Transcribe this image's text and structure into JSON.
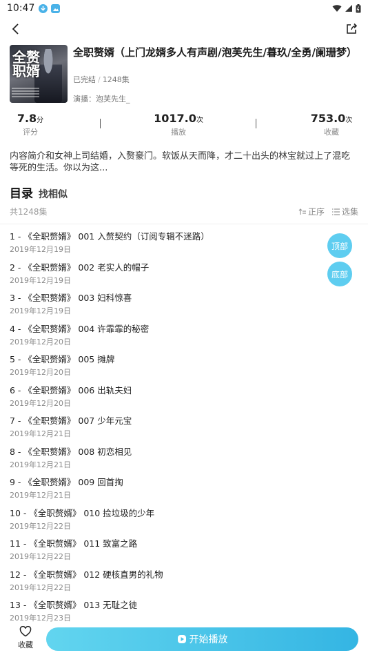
{
  "status_bar": {
    "time": "10:47"
  },
  "book": {
    "title": "全职赘婿（上门龙婿多人有声剧/泡芙先生/暮玖/全勇/阑珊梦）",
    "status": "已完结",
    "episodes": "1248集",
    "cast_label": "演播：泡芙先生_",
    "cover_art_text": "全赘职婿"
  },
  "stats": [
    {
      "value": "7.8",
      "unit": "分",
      "label": "评分"
    },
    {
      "value": "1017.0",
      "unit": "次",
      "label": "播放"
    },
    {
      "value": "753.0",
      "unit": "次",
      "label": "收藏"
    }
  ],
  "intro": "内容简介和女神上司结婚，入赘豪门。软饭从天而降，才二十出头的林宝就过上了混吃等死的生活。你以为这...",
  "toc": {
    "title": "目录",
    "similar": "找相似",
    "count": "共1248集",
    "order": "正序",
    "select": "选集"
  },
  "episodes": [
    {
      "title": "1 - 《全职赘婿》 001 入赘契约（订阅专辑不迷路）",
      "date": "2019年12月19日"
    },
    {
      "title": "2 - 《全职赘婿》 002 老实人的帽子",
      "date": "2019年12月19日"
    },
    {
      "title": "3 - 《全职赘婿》 003 妇科惊喜",
      "date": "2019年12月19日"
    },
    {
      "title": "4 - 《全职赘婿》 004 许霏霏的秘密",
      "date": "2019年12月20日"
    },
    {
      "title": "5 - 《全职赘婿》 005 摊牌",
      "date": "2019年12月20日"
    },
    {
      "title": "6 - 《全职赘婿》 006 出轨夫妇",
      "date": "2019年12月20日"
    },
    {
      "title": "7 - 《全职赘婿》 007 少年元宝",
      "date": "2019年12月21日"
    },
    {
      "title": "8 - 《全职赘婿》 008 初恋相见",
      "date": "2019年12月21日"
    },
    {
      "title": "9 - 《全职赘婿》 009 回首掏",
      "date": "2019年12月21日"
    },
    {
      "title": "10 - 《全职赘婿》 010 捡垃圾的少年",
      "date": "2019年12月22日"
    },
    {
      "title": "11 - 《全职赘婿》 011 致富之路",
      "date": "2019年12月22日"
    },
    {
      "title": "12 - 《全职赘婿》 012 硬核直男的礼物",
      "date": "2019年12月22日"
    },
    {
      "title": "13 - 《全职赘婿》 013 无耻之徒",
      "date": "2019年12月23日"
    }
  ],
  "float_buttons": {
    "top": "顶部",
    "bottom": "底部"
  },
  "bottom": {
    "favorite": "收藏",
    "play": "开始播放"
  },
  "colors": {
    "accent": "#5ecdf0",
    "play_start": "#62d5ef",
    "play_end": "#34b5e3"
  },
  "icons": [
    "download-icon",
    "image-icon",
    "wifi-icon",
    "signal-icon",
    "battery-icon",
    "back-arrow-icon",
    "share-icon",
    "sort-icon",
    "list-icon",
    "heart-icon",
    "play-icon"
  ]
}
